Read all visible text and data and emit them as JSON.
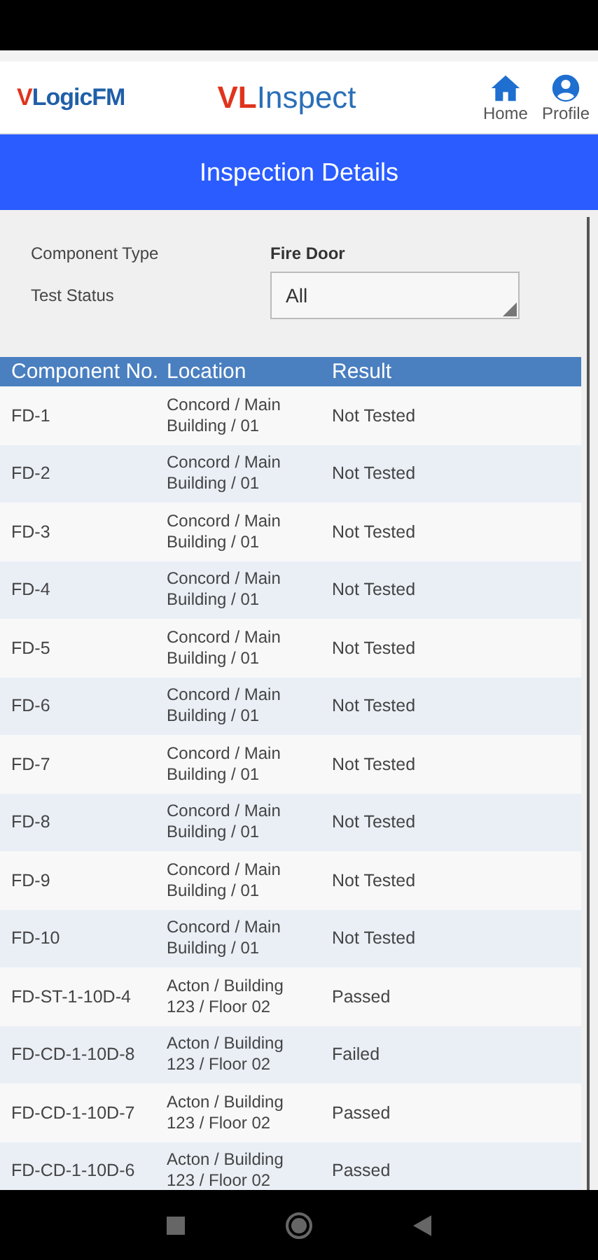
{
  "header": {
    "brand_logo": {
      "accent": "V",
      "rest": "LogicFM"
    },
    "app_logo": {
      "accent": "VL",
      "rest": "Inspect"
    },
    "nav": [
      {
        "label": "Home",
        "kind": "home"
      },
      {
        "label": "Profile",
        "kind": "profile"
      }
    ]
  },
  "title_bar": {
    "title": "Inspection Details"
  },
  "filters": {
    "component_type": {
      "label": "Component Type",
      "value": "Fire Door"
    },
    "test_status": {
      "label": "Test Status",
      "value": "All"
    }
  },
  "table": {
    "columns": [
      "Component No.",
      "Location",
      "Result"
    ],
    "rows": [
      {
        "component": "FD-1",
        "location": "Concord / Main Building / 01",
        "result": "Not Tested"
      },
      {
        "component": "FD-2",
        "location": "Concord / Main Building / 01",
        "result": "Not Tested"
      },
      {
        "component": "FD-3",
        "location": "Concord / Main Building / 01",
        "result": "Not Tested"
      },
      {
        "component": "FD-4",
        "location": "Concord / Main Building / 01",
        "result": "Not Tested"
      },
      {
        "component": "FD-5",
        "location": "Concord / Main Building / 01",
        "result": "Not Tested"
      },
      {
        "component": "FD-6",
        "location": "Concord / Main Building / 01",
        "result": "Not Tested"
      },
      {
        "component": "FD-7",
        "location": "Concord / Main Building / 01",
        "result": "Not Tested"
      },
      {
        "component": "FD-8",
        "location": "Concord / Main Building / 01",
        "result": "Not Tested"
      },
      {
        "component": "FD-9",
        "location": "Concord / Main Building / 01",
        "result": "Not Tested"
      },
      {
        "component": "FD-10",
        "location": "Concord / Main Building / 01",
        "result": "Not Tested"
      },
      {
        "component": "FD-ST-1-10D-4",
        "location": "Acton / Building 123 / Floor 02",
        "result": "Passed"
      },
      {
        "component": "FD-CD-1-10D-8",
        "location": "Acton / Building 123 / Floor 02",
        "result": "Failed"
      },
      {
        "component": "FD-CD-1-10D-7",
        "location": "Acton / Building 123 / Floor 02",
        "result": "Passed"
      },
      {
        "component": "FD-CD-1-10D-6",
        "location": "Acton / Building 123 / Floor 02",
        "result": "Passed"
      }
    ]
  }
}
